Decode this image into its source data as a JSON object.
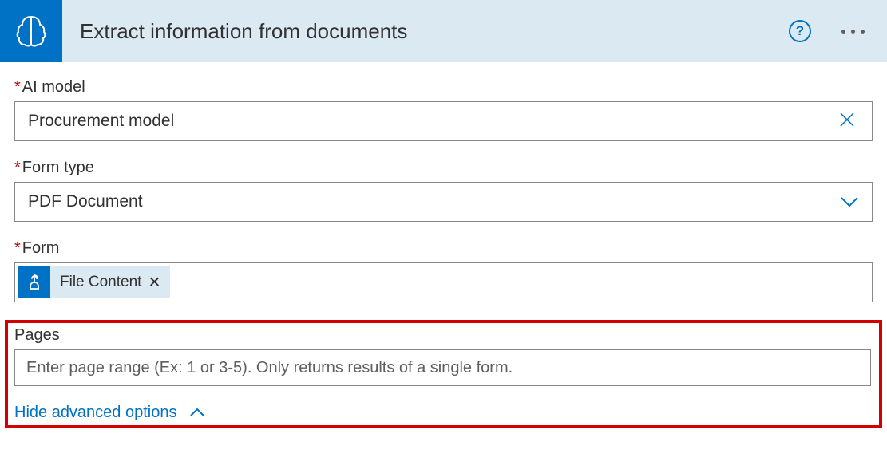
{
  "header": {
    "title": "Extract information from documents"
  },
  "fields": {
    "aiModel": {
      "label": "AI model",
      "value": "Procurement model"
    },
    "formType": {
      "label": "Form type",
      "value": "PDF Document"
    },
    "form": {
      "label": "Form",
      "tokenLabel": "File Content"
    },
    "pages": {
      "label": "Pages",
      "placeholder": "Enter page range (Ex: 1 or 3-5). Only returns results of a single form."
    }
  },
  "footer": {
    "hideAdvanced": "Hide advanced options"
  }
}
